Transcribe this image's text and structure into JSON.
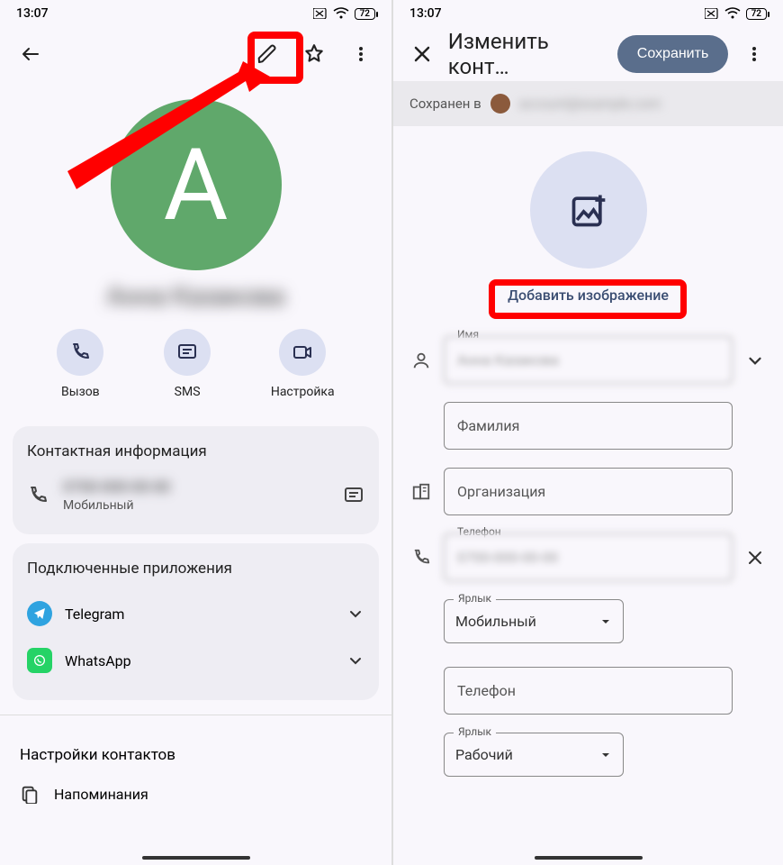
{
  "status": {
    "time": "13:07",
    "battery": "72"
  },
  "left": {
    "avatar_letter": "А",
    "contact_name": "Анна Казакова",
    "actions": {
      "call": "Вызов",
      "sms": "SMS",
      "video": "Настройка"
    },
    "info_section_title": "Контактная информация",
    "phone_value": "0700-000-00-00",
    "phone_type": "Мобильный",
    "apps_section_title": "Подключенные приложения",
    "apps": [
      {
        "name": "Telegram",
        "color": "#2fa3e0"
      },
      {
        "name": "WhatsApp",
        "color": "#25d366"
      }
    ],
    "settings_title": "Настройки контактов",
    "reminders": "Напоминания"
  },
  "right": {
    "title": "Изменить конт…",
    "save": "Сохранить",
    "saved_in": "Сохранен в",
    "saved_account": "account@example.com",
    "add_image": "Добавить изображение",
    "label_name": "Имя",
    "name_value": "Анна Казакова",
    "lastname_placeholder": "Фамилия",
    "org_placeholder": "Организация",
    "label_phone": "Телефон",
    "phone_value": "0700-000-00-00",
    "label_tag": "Ярлык",
    "tag_mobile": "Мобильный",
    "phone2_placeholder": "Телефон",
    "tag_work": "Рабочий"
  }
}
